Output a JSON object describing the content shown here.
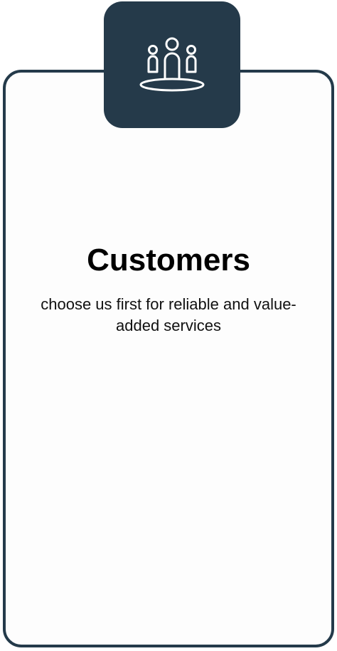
{
  "card": {
    "icon": "people-group-icon",
    "title": "Customers",
    "description": "choose us first for reliable and value-added services"
  },
  "colors": {
    "accent": "#253a4a",
    "card_background": "#fdfdfd",
    "text": "#000000"
  }
}
